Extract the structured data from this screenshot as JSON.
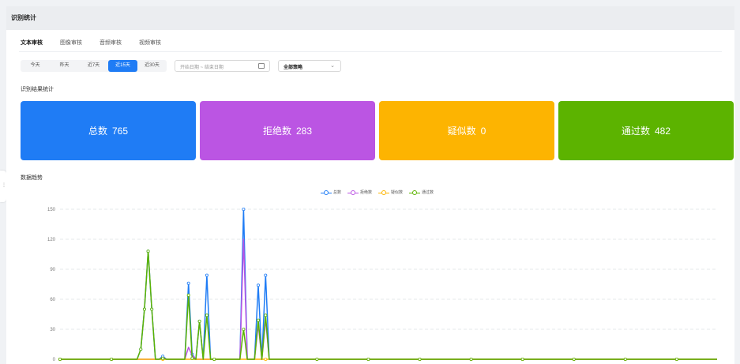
{
  "header": {
    "title": "识别统计"
  },
  "tabs": [
    {
      "label": "文本审核",
      "active": true
    },
    {
      "label": "图像审核",
      "active": false
    },
    {
      "label": "音频审核",
      "active": false
    },
    {
      "label": "视频审核",
      "active": false
    }
  ],
  "filters": {
    "ranges": [
      {
        "label": "今天",
        "active": false
      },
      {
        "label": "昨天",
        "active": false
      },
      {
        "label": "近7天",
        "active": false
      },
      {
        "label": "近15天",
        "active": true
      },
      {
        "label": "近30天",
        "active": false
      }
    ],
    "date_placeholder": "开始日期 ~ 结束日期",
    "strategy": "全部策略"
  },
  "stats_section": {
    "title": "识别结果统计"
  },
  "stats": [
    {
      "label": "总数",
      "value": "765",
      "color": "#1f7cf5"
    },
    {
      "label": "拒绝数",
      "value": "283",
      "color": "#bb55e3"
    },
    {
      "label": "疑似数",
      "value": "0",
      "color": "#fdb401"
    },
    {
      "label": "通过数",
      "value": "482",
      "color": "#5cb300"
    }
  ],
  "trend_section": {
    "title": "数据趋势"
  },
  "chart_data": {
    "type": "line",
    "title": "",
    "xlabel": "",
    "ylabel": "",
    "ylim": [
      0,
      150
    ],
    "yticks": [
      0,
      30,
      60,
      90,
      120,
      150
    ],
    "grid": true,
    "legend_position": "top-center",
    "x": [
      0,
      1,
      2,
      3,
      4,
      5,
      6,
      7,
      8,
      9,
      10,
      11,
      12,
      13,
      14,
      15,
      16,
      17,
      18,
      19,
      20,
      21,
      22,
      23,
      24,
      25,
      26,
      27,
      28,
      29,
      30,
      31,
      32,
      33,
      34,
      35,
      36,
      37,
      38,
      39,
      40,
      41,
      42,
      43,
      44,
      45,
      46,
      47,
      48,
      49,
      50,
      51,
      52,
      53,
      54,
      55,
      56,
      57,
      58,
      59,
      60,
      61,
      62,
      63,
      64,
      65,
      66,
      67,
      68,
      69,
      70,
      71,
      72,
      73,
      74,
      75,
      76,
      77,
      78,
      79,
      80,
      81,
      82,
      83,
      84,
      85,
      86,
      87,
      88,
      89,
      90,
      91,
      92,
      93,
      94,
      95,
      96,
      97,
      98,
      99,
      100,
      101,
      102,
      103,
      104,
      105,
      106,
      107,
      108,
      109,
      110,
      111,
      112,
      113,
      114,
      115,
      116,
      117,
      118,
      119,
      120,
      121,
      122,
      123,
      124,
      125,
      126,
      127,
      128,
      129,
      130,
      131,
      132,
      133,
      134,
      135,
      136,
      137,
      138,
      139,
      140,
      141,
      142,
      143,
      144,
      145,
      146,
      147,
      148,
      149,
      150,
      151,
      152,
      153,
      154,
      155,
      156,
      157,
      158,
      159,
      160,
      161,
      162,
      163,
      164,
      165,
      166,
      167,
      168,
      169,
      170,
      171,
      172,
      173,
      174,
      175,
      176,
      177,
      178,
      179
    ],
    "series": [
      {
        "name": "总数",
        "color": "#1f7cf5",
        "values": [
          0,
          0,
          0,
          0,
          0,
          0,
          0,
          0,
          0,
          0,
          0,
          0,
          0,
          0,
          0,
          0,
          0,
          0,
          0,
          0,
          0,
          0,
          10,
          50,
          108,
          50,
          0,
          0,
          3,
          0,
          0,
          0,
          0,
          0,
          0,
          76,
          5,
          0,
          38,
          0,
          84,
          0,
          0,
          0,
          0,
          0,
          0,
          0,
          0,
          0,
          150,
          0,
          0,
          0,
          74,
          0,
          84,
          0,
          0,
          0,
          0,
          0,
          0,
          0,
          0,
          0,
          0,
          0,
          0,
          0,
          0,
          0,
          0,
          0,
          0,
          0,
          0,
          0,
          0,
          0,
          0,
          0,
          0,
          0,
          0,
          0,
          0,
          0,
          0,
          0,
          0,
          0,
          0,
          0,
          0,
          0,
          0,
          0,
          0,
          0,
          0,
          0,
          0,
          0,
          0,
          0,
          0,
          0,
          0,
          0,
          0,
          0,
          0,
          0,
          0,
          0,
          0,
          0,
          0,
          0,
          0,
          0,
          0,
          0,
          0,
          0,
          0,
          0,
          0,
          0,
          0,
          0,
          0,
          0,
          0,
          0,
          0,
          0,
          0,
          0,
          0,
          0,
          0,
          0,
          0,
          0,
          0,
          0,
          0,
          0,
          0,
          0,
          0,
          0,
          0,
          0,
          0,
          0,
          0,
          0,
          0,
          0,
          0,
          0,
          0,
          0,
          0,
          0,
          0,
          0,
          0,
          0,
          0,
          0,
          0,
          0,
          0,
          0,
          0,
          0
        ]
      },
      {
        "name": "拒绝数",
        "color": "#bb55e3",
        "values": [
          0,
          0,
          0,
          0,
          0,
          0,
          0,
          0,
          0,
          0,
          0,
          0,
          0,
          0,
          0,
          0,
          0,
          0,
          0,
          0,
          0,
          0,
          0,
          0,
          0,
          0,
          0,
          0,
          2,
          0,
          0,
          0,
          0,
          0,
          0,
          12,
          4,
          0,
          0,
          0,
          0,
          0,
          0,
          0,
          0,
          0,
          0,
          0,
          0,
          0,
          120,
          0,
          0,
          0,
          35,
          0,
          40,
          0,
          0,
          0,
          0,
          0,
          0,
          0,
          0,
          0,
          0,
          0,
          0,
          0,
          0,
          0,
          0,
          0,
          0,
          0,
          0,
          0,
          0,
          0,
          0,
          0,
          0,
          0,
          0,
          0,
          0,
          0,
          0,
          0,
          0,
          0,
          0,
          0,
          0,
          0,
          0,
          0,
          0,
          0,
          0,
          0,
          0,
          0,
          0,
          0,
          0,
          0,
          0,
          0,
          0,
          0,
          0,
          0,
          0,
          0,
          0,
          0,
          0,
          0,
          0,
          0,
          0,
          0,
          0,
          0,
          0,
          0,
          0,
          0,
          0,
          0,
          0,
          0,
          0,
          0,
          0,
          0,
          0,
          0,
          0,
          0,
          0,
          0,
          0,
          0,
          0,
          0,
          0,
          0,
          0,
          0,
          0,
          0,
          0,
          0,
          0,
          0,
          0,
          0,
          0,
          0,
          0,
          0,
          0,
          0,
          0,
          0,
          0,
          0,
          0,
          0,
          0,
          0,
          0,
          0,
          0,
          0,
          0,
          0
        ]
      },
      {
        "name": "疑似数",
        "color": "#fdb401",
        "values": [
          0,
          0,
          0,
          0,
          0,
          0,
          0,
          0,
          0,
          0,
          0,
          0,
          0,
          0,
          0,
          0,
          0,
          0,
          0,
          0,
          0,
          0,
          0,
          0,
          0,
          0,
          0,
          0,
          0,
          0,
          0,
          0,
          0,
          0,
          0,
          0,
          0,
          0,
          0,
          0,
          0,
          0,
          0,
          0,
          0,
          0,
          0,
          0,
          0,
          0,
          0,
          0,
          0,
          0,
          0,
          0,
          0,
          0,
          0,
          0,
          0,
          0,
          0,
          0,
          0,
          0,
          0,
          0,
          0,
          0,
          0,
          0,
          0,
          0,
          0,
          0,
          0,
          0,
          0,
          0,
          0,
          0,
          0,
          0,
          0,
          0,
          0,
          0,
          0,
          0,
          0,
          0,
          0,
          0,
          0,
          0,
          0,
          0,
          0,
          0,
          0,
          0,
          0,
          0,
          0,
          0,
          0,
          0,
          0,
          0,
          0,
          0,
          0,
          0,
          0,
          0,
          0,
          0,
          0,
          0,
          0,
          0,
          0,
          0,
          0,
          0,
          0,
          0,
          0,
          0,
          0,
          0,
          0,
          0,
          0,
          0,
          0,
          0,
          0,
          0,
          0,
          0,
          0,
          0,
          0,
          0,
          0,
          0,
          0,
          0,
          0,
          0,
          0,
          0,
          0,
          0,
          0,
          0,
          0,
          0,
          0,
          0,
          0,
          0,
          0,
          0,
          0,
          0,
          0,
          0,
          0,
          0,
          0,
          0,
          0,
          0,
          0,
          0,
          0,
          0
        ]
      },
      {
        "name": "通过数",
        "color": "#5cb300",
        "values": [
          0,
          0,
          0,
          0,
          0,
          0,
          0,
          0,
          0,
          0,
          0,
          0,
          0,
          0,
          0,
          0,
          0,
          0,
          0,
          0,
          0,
          0,
          10,
          50,
          108,
          50,
          0,
          0,
          1,
          0,
          0,
          0,
          0,
          0,
          0,
          64,
          1,
          0,
          38,
          0,
          44,
          0,
          0,
          0,
          0,
          0,
          0,
          0,
          0,
          0,
          30,
          0,
          0,
          0,
          39,
          0,
          44,
          0,
          0,
          0,
          0,
          0,
          0,
          0,
          0,
          0,
          0,
          0,
          0,
          0,
          0,
          0,
          0,
          0,
          0,
          0,
          0,
          0,
          0,
          0,
          0,
          0,
          0,
          0,
          0,
          0,
          0,
          0,
          0,
          0,
          0,
          0,
          0,
          0,
          0,
          0,
          0,
          0,
          0,
          0,
          0,
          0,
          0,
          0,
          0,
          0,
          0,
          0,
          0,
          0,
          0,
          0,
          0,
          0,
          0,
          0,
          0,
          0,
          0,
          0,
          0,
          0,
          0,
          0,
          0,
          0,
          0,
          0,
          0,
          0,
          0,
          0,
          0,
          0,
          0,
          0,
          0,
          0,
          0,
          0,
          0,
          0,
          0,
          0,
          0,
          0,
          0,
          0,
          0,
          0,
          0,
          0,
          0,
          0,
          0,
          0,
          0,
          0,
          0,
          0,
          0,
          0,
          0,
          0,
          0,
          0,
          0,
          0,
          0,
          0,
          0,
          0,
          0,
          0,
          0,
          0,
          0,
          0,
          0,
          0
        ]
      }
    ]
  }
}
